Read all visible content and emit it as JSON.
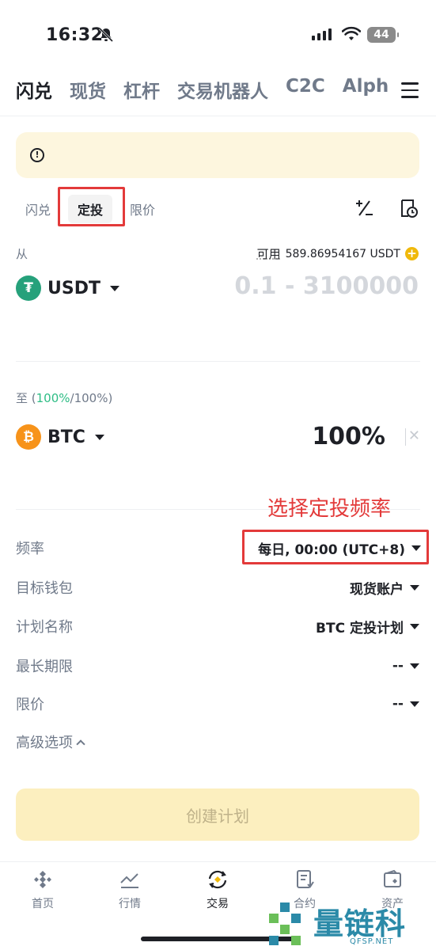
{
  "status_bar": {
    "time": "16:32",
    "battery": "44"
  },
  "top_tabs": [
    {
      "label": "闪兑",
      "active": true
    },
    {
      "label": "现货",
      "active": false
    },
    {
      "label": "杠杆",
      "active": false
    },
    {
      "label": "交易机器人",
      "active": false
    },
    {
      "label": "C2C",
      "active": false
    },
    {
      "label": "Alpha",
      "active": false
    }
  ],
  "sub_tabs": [
    {
      "label": "闪兑",
      "active": false
    },
    {
      "label": "定投",
      "active": true
    },
    {
      "label": "限价",
      "active": false
    }
  ],
  "from": {
    "label": "从",
    "available_label": "可用",
    "available_value": "589.86954167 USDT",
    "coin": "USDT",
    "amount_placeholder": "0.1 - 3100000"
  },
  "to": {
    "label_prefix": "至 (",
    "label_green": "100%",
    "label_suffix": "/100%)",
    "coin": "BTC",
    "percent": "100%"
  },
  "annotation": "选择定投频率",
  "settings": [
    {
      "key": "频率",
      "value": "每日, 00:00 (UTC+8)"
    },
    {
      "key": "目标钱包",
      "value": "现货账户"
    },
    {
      "key": "计划名称",
      "value": "BTC 定投计划"
    },
    {
      "key": "最长期限",
      "value": "--"
    },
    {
      "key": "限价",
      "value": "--"
    }
  ],
  "advanced_label": "高级选项",
  "create_button": "创建计划",
  "bottom_nav": [
    {
      "label": "首页",
      "icon": "home-icon"
    },
    {
      "label": "行情",
      "icon": "markets-icon"
    },
    {
      "label": "交易",
      "icon": "trade-icon",
      "active": true
    },
    {
      "label": "合约",
      "icon": "futures-icon"
    },
    {
      "label": "资产",
      "icon": "wallet-icon"
    }
  ],
  "watermark": {
    "text": "量链科技",
    "sub": "QFSP.NET"
  },
  "colors": {
    "accent": "#f0b90b",
    "annotation_red": "#e33a3a",
    "green": "#2ebd85",
    "usdt": "#26a17b",
    "btc": "#f7931a"
  }
}
